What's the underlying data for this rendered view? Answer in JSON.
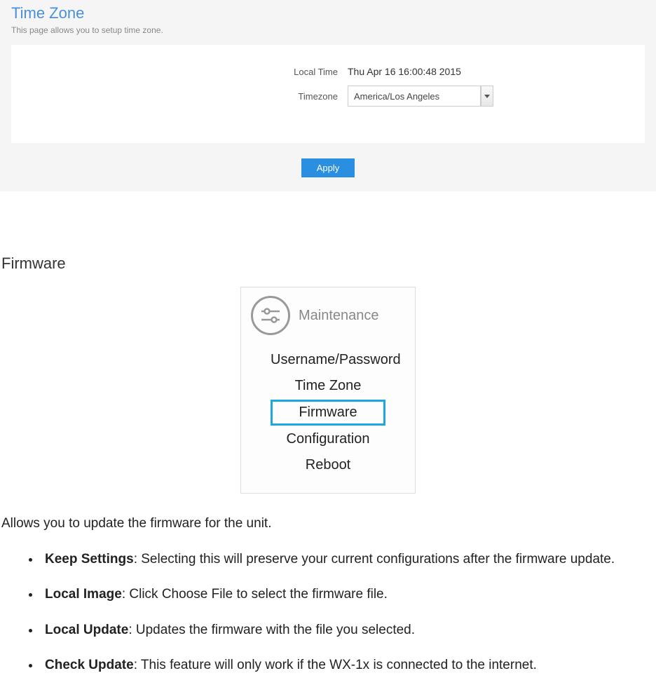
{
  "timezone_panel": {
    "title": "Time Zone",
    "subtitle": "This page allows you to setup time zone.",
    "local_time_label": "Local Time",
    "local_time_value": "Thu Apr 16 16:00:48 2015",
    "timezone_label": "Timezone",
    "timezone_value": "America/Los Angeles",
    "apply_label": "Apply"
  },
  "section": {
    "heading": "Firmware",
    "intro": "Allows you to update the firmware for the unit."
  },
  "menu": {
    "header": "Maintenance",
    "items": [
      {
        "label": "Username/Password",
        "selected": false
      },
      {
        "label": "Time Zone",
        "selected": false
      },
      {
        "label": "Firmware",
        "selected": true
      },
      {
        "label": "Configuration",
        "selected": false
      },
      {
        "label": "Reboot",
        "selected": false
      }
    ]
  },
  "bullets": [
    {
      "term": "Keep Settings",
      "desc": ": Selecting this will preserve your current configurations after the firmware update."
    },
    {
      "term": "Local Image",
      "desc": ": Click Choose File to select the firmware file."
    },
    {
      "term": "Local Update",
      "desc": ": Updates the firmware with the file you selected."
    },
    {
      "term": "Check Update",
      "desc": ": This feature will only work if the WX-1x is connected to the internet."
    }
  ]
}
